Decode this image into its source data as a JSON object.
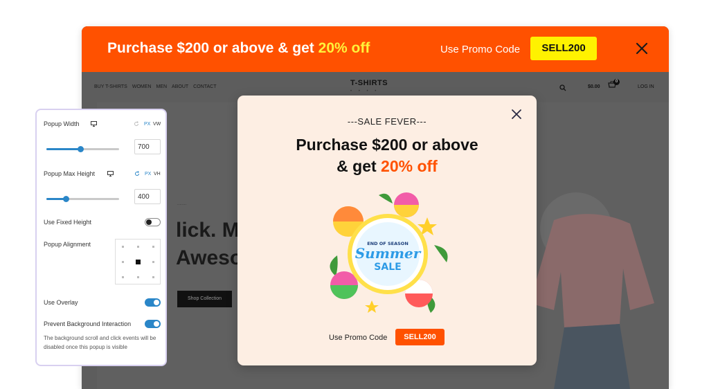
{
  "topbar": {
    "title_main": "Purchase $200 or above & get ",
    "title_highlight": "20% off",
    "promo_label": "Use Promo Code",
    "promo_code": "SELL200"
  },
  "site": {
    "nav": [
      "BUY T-SHIRTS",
      "WOMEN",
      "MEN",
      "ABOUT",
      "CONTACT"
    ],
    "logo": "T-SHIRTS",
    "cart_price": "$0.00",
    "cart_count": "0",
    "login": "LOG IN",
    "hero_line1": "lick. Mo",
    "hero_line2": "Aweson",
    "hero_button": "Shop Collection"
  },
  "panel": {
    "popup_width_label": "Popup Width",
    "unit_px": "PX",
    "unit_vw": "VW",
    "unit_vh": "VH",
    "popup_width_value": "700",
    "popup_width_level": 0.47,
    "popup_max_height_label": "Popup Max Height",
    "popup_max_height_value": "400",
    "popup_max_height_level": 0.27,
    "fixed_height_label": "Use Fixed Height",
    "fixed_height_on": false,
    "alignment_label": "Popup Alignment",
    "alignment_selected": "center",
    "overlay_label": "Use Overlay",
    "overlay_on": true,
    "prevent_bg_label": "Prevent Background Interaction",
    "prevent_bg_on": true,
    "help_text": "The background scroll and click events will be disabled once this popup is visible"
  },
  "popup": {
    "pretitle": "---SALE FEVER---",
    "headline_1": "Purchase $200 or above",
    "headline_2_prefix": "& get ",
    "headline_2_highlight": "20% off",
    "art_small": "END OF SEASON",
    "art_big_1": "Summer",
    "art_big_2": "SALE",
    "promo_label": "Use Promo Code",
    "promo_code": "SELL200"
  },
  "colors": {
    "brand_orange": "#ff5100",
    "promo_yellow": "#fff200",
    "accent_blue": "#2a86c8",
    "popup_bg": "#fdeee3"
  }
}
